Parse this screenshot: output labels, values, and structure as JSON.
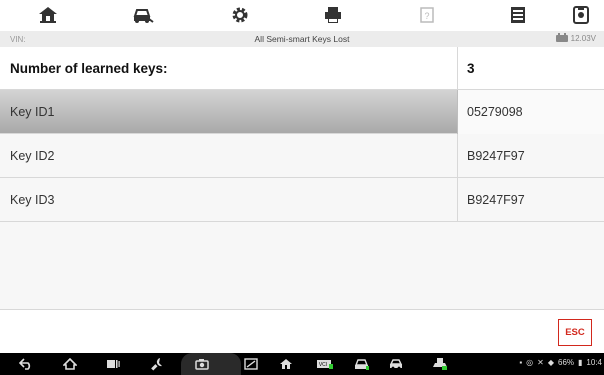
{
  "toolbar": {
    "icons": [
      "home-icon",
      "vehicle-icon",
      "settings-icon",
      "print-icon",
      "help-icon",
      "data-logging-icon",
      "screenshot-icon"
    ]
  },
  "status": {
    "vin_label": "VIN:",
    "title": "All Semi-smart Keys Lost",
    "voltage": "12.03V"
  },
  "table": {
    "header": {
      "label": "Number of learned keys:",
      "value": "3"
    },
    "rows": [
      {
        "label": "Key ID1",
        "value": "05279098"
      },
      {
        "label": "Key ID2",
        "value": "B9247F97"
      },
      {
        "label": "Key ID3",
        "value": "B9247F97"
      }
    ]
  },
  "actions": {
    "esc_label": "ESC"
  },
  "system": {
    "battery_percent": "66%",
    "time": "10:4"
  },
  "colors": {
    "accent": "#d2281d",
    "navbar": "#000000"
  }
}
